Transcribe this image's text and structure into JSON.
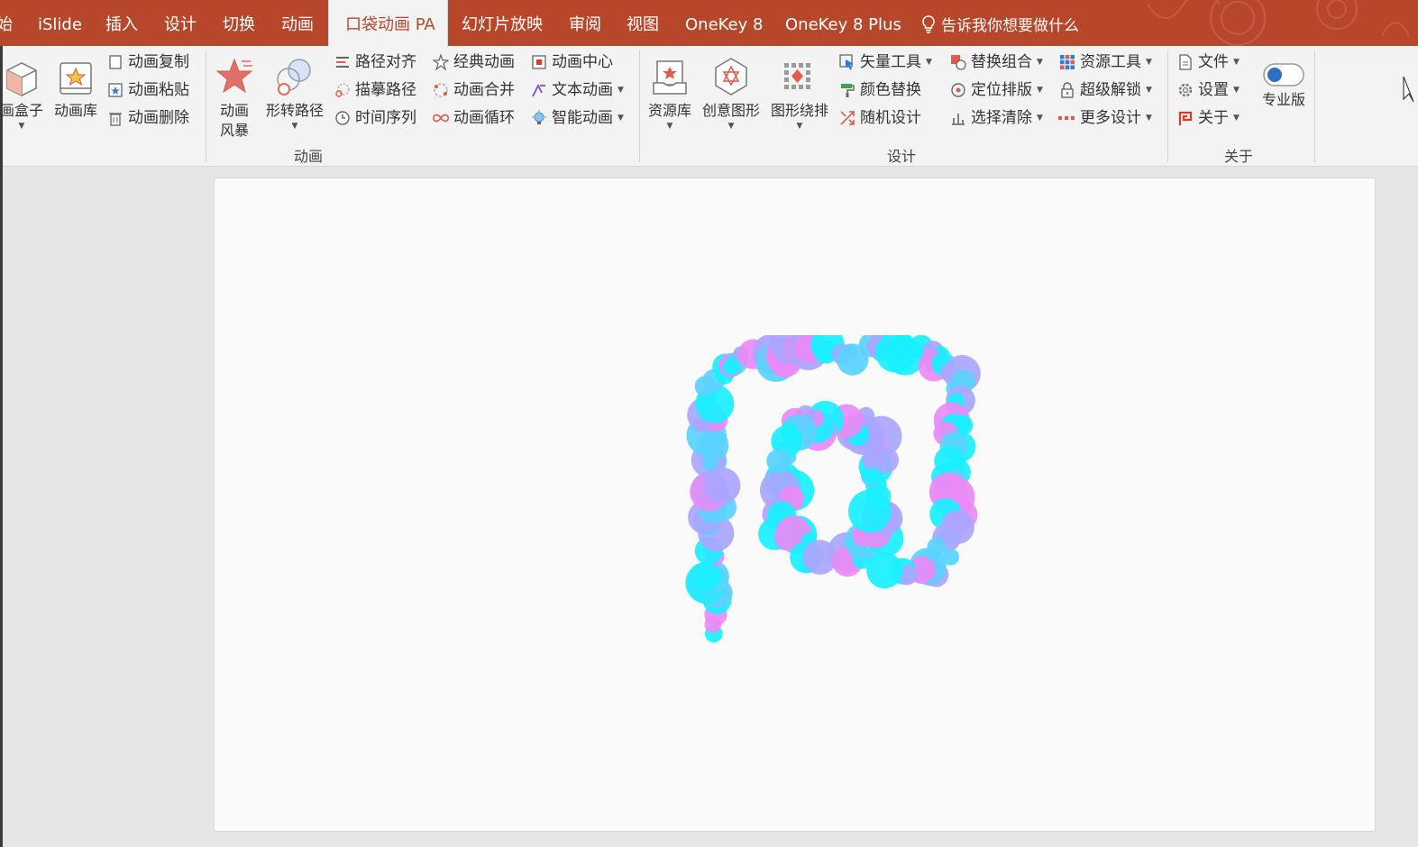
{
  "tabs": [
    {
      "label": "始",
      "active": false
    },
    {
      "label": "iSlide",
      "active": false
    },
    {
      "label": "插入",
      "active": false
    },
    {
      "label": "设计",
      "active": false
    },
    {
      "label": "切换",
      "active": false
    },
    {
      "label": "动画",
      "active": false
    },
    {
      "label": "口袋动画 PA",
      "active": true
    },
    {
      "label": "幻灯片放映",
      "active": false
    },
    {
      "label": "审阅",
      "active": false
    },
    {
      "label": "视图",
      "active": false
    },
    {
      "label": "OneKey 8",
      "active": false
    },
    {
      "label": "OneKey 8 Plus",
      "active": false
    }
  ],
  "tell_me": "告诉我你想要做什么",
  "ribbon": {
    "animation_group": {
      "label": "动画",
      "box": "画盒子",
      "library": "动画库",
      "copy": "动画复制",
      "paste": "动画粘贴",
      "delete": "动画删除",
      "storm_line1": "动画",
      "storm_line2": "风暴",
      "shape_path": "形转路径",
      "path_align": "路径对齐",
      "trace_path": "描摹路径",
      "time_sequence": "时间序列",
      "classic": "经典动画",
      "merge": "动画合并",
      "loop": "动画循环",
      "center": "动画中心",
      "text_anim": "文本动画",
      "smart_anim": "智能动画"
    },
    "design_group": {
      "label": "设计",
      "resource_lib": "资源库",
      "creative_shape": "创意图形",
      "shape_layout": "图形绕排",
      "vector_tool": "矢量工具",
      "color_replace": "颜色替换",
      "random_design": "随机设计",
      "replace_combine": "替换组合",
      "position_layout": "定位排版",
      "select_clear": "选择清除",
      "resource_tool": "资源工具",
      "super_unlock": "超级解锁",
      "more_design": "更多设计"
    },
    "about_group": {
      "label": "关于",
      "file": "文件",
      "settings": "设置",
      "about": "关于",
      "pro": "专业版"
    }
  },
  "colors": {
    "tab_bar": "#b7472a",
    "ribbon_bg": "#f3f3f3",
    "circle_cyan": "#19f0ff",
    "circle_blue": "#5ad2ff",
    "circle_violet": "#a9a6ff",
    "circle_pink": "#e98af5"
  }
}
